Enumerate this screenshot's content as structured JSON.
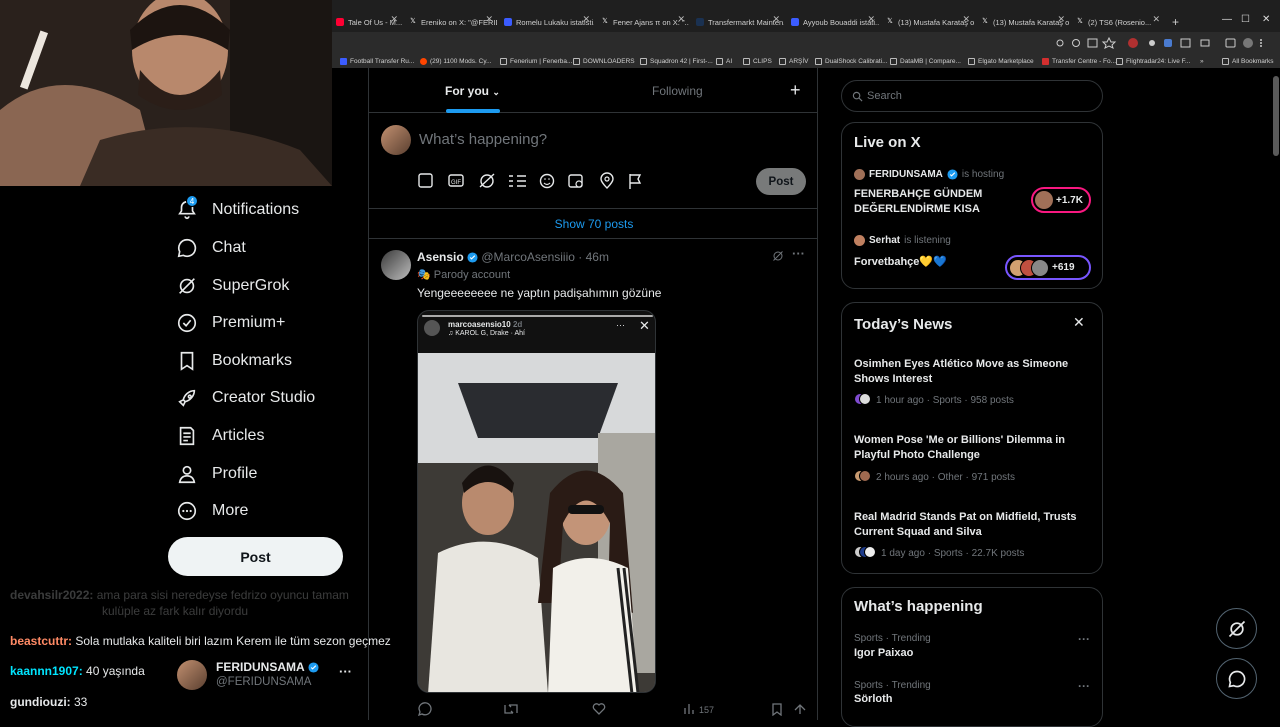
{
  "browser": {
    "tabs": [
      {
        "title": "Tale Of Us - M...",
        "color": "#ff0033"
      },
      {
        "title": "Ereniko on X: \"@FERID...",
        "color": "#000000"
      },
      {
        "title": "Romelu Lukaku istatisti...",
        "color": "#3b5cff"
      },
      {
        "title": "Fener Ajans π on X: \"...",
        "color": "#000000"
      },
      {
        "title": "Transfermarkt Mainten...",
        "color": "#1a3151"
      },
      {
        "title": "Ayyoub Bouaddi istati...",
        "color": "#3b5cff"
      },
      {
        "title": "(13) Mustafa Karataş o...",
        "color": "#000000"
      },
      {
        "title": "(13) Mustafa Karataş o...",
        "color": "#000000"
      },
      {
        "title": "(2) TS6 (Rosenio...",
        "color": "#000000"
      }
    ],
    "new_tab": "+",
    "bookmarks": [
      "Football Transfer Ru...",
      "(29) 1100 Mods. Cy...",
      "Fenerium | Fenerba...",
      "DOWNLOADERS",
      "Squadron 42 | First-...",
      "AI",
      "CLIPS",
      "ARŞİV",
      "DualShock Calibrati...",
      "DataMB | Compare...",
      "Elgato Marketplace",
      "Transfer Centre - Fo...",
      "Flightradar24: Live F...",
      "All Bookmarks"
    ]
  },
  "sidebar": {
    "items": [
      {
        "label": "Notifications",
        "icon": "bell-icon",
        "badge": "4"
      },
      {
        "label": "Chat",
        "icon": "chat-icon"
      },
      {
        "label": "SuperGrok",
        "icon": "grok-icon"
      },
      {
        "label": "Premium+",
        "icon": "premium-icon"
      },
      {
        "label": "Bookmarks",
        "icon": "bookmark-icon"
      },
      {
        "label": "Creator Studio",
        "icon": "rocket-icon"
      },
      {
        "label": "Articles",
        "icon": "article-icon"
      },
      {
        "label": "Profile",
        "icon": "person-icon"
      },
      {
        "label": "More",
        "icon": "more-circle-icon"
      }
    ],
    "post_label": "Post",
    "account": {
      "name": "FERIDUNSAMA",
      "handle": "@FERIDUNSAMA",
      "more": "···"
    }
  },
  "chat": [
    {
      "user": "devahsilr2022:",
      "text": "ama para sisi neredeyse fedrizo oyuncu tamam",
      "user_color": "#3a3a3a",
      "faded": true
    },
    {
      "user": "",
      "text": "kulüple az fark kalır diyordu",
      "user_color": "#3a3a3a",
      "faded": true
    },
    {
      "user": "beastcuttr:",
      "text": "Sola mutlaka kaliteli biri lazım Kerem ile tüm sezon geçmez",
      "user_color": "#ff8a65"
    },
    {
      "user": "kaannn1907:",
      "text": "40 yaşında",
      "user_color": "#00e5ff"
    },
    {
      "user": "gundiouzi:",
      "text": "33",
      "user_color": "#ffffff"
    }
  ],
  "main": {
    "tabs": [
      {
        "label": "For you",
        "active": true
      },
      {
        "label": "Following",
        "active": false
      }
    ],
    "add_tab": "+",
    "compose_placeholder": "What’s happening?",
    "compose_post": "Post",
    "show_posts": "Show 70 posts",
    "tweet": {
      "name": "Asensio",
      "handle": "@MarcoAsensiiio",
      "time": "· 46m",
      "label": "Parody account",
      "text": "Yengeeeeeeee ne yaptın padişahımın gözüne",
      "story": {
        "user": "marcoasensio10",
        "time": "2d",
        "music": "KAROL G, Drake · Ahí"
      },
      "stats": {
        "views": "157"
      }
    }
  },
  "right": {
    "search_placeholder": "Search",
    "live": {
      "title": "Live on X",
      "items": [
        {
          "host": "FERIDUNSAMA",
          "status": "is hosting",
          "title": "FENERBAHÇE GÜNDEM DEĞERLENDİRME KISA",
          "count": "+1.7K"
        },
        {
          "host": "Serhat",
          "status": "is listening",
          "title": "Forvetbahçe💛💙",
          "count": "+619"
        }
      ]
    },
    "news": {
      "title": "Today’s News",
      "items": [
        {
          "title": "Osimhen Eyes Atlético Move as Simeone Shows Interest",
          "meta": "1 hour ago · Sports · 958 posts"
        },
        {
          "title": "Women Pose 'Me or Billions' Dilemma in Playful Photo Challenge",
          "meta": "2 hours ago · Other · 971 posts"
        },
        {
          "title": "Real Madrid Stands Pat on Midfield, Trusts Current Squad and Silva",
          "meta": "1 day ago · Sports · 22.7K posts"
        }
      ]
    },
    "happening": {
      "title": "What’s happening",
      "items": [
        {
          "context": "Sports · Trending",
          "topic": "Igor Paixao"
        },
        {
          "context": "Sports · Trending",
          "topic": "Sörloth"
        }
      ]
    }
  },
  "colors": {
    "accent": "#1d9bf0",
    "border": "#2f3336",
    "muted": "#71767b",
    "live_pink": "#f91880",
    "live_purple": "#7856ff"
  }
}
